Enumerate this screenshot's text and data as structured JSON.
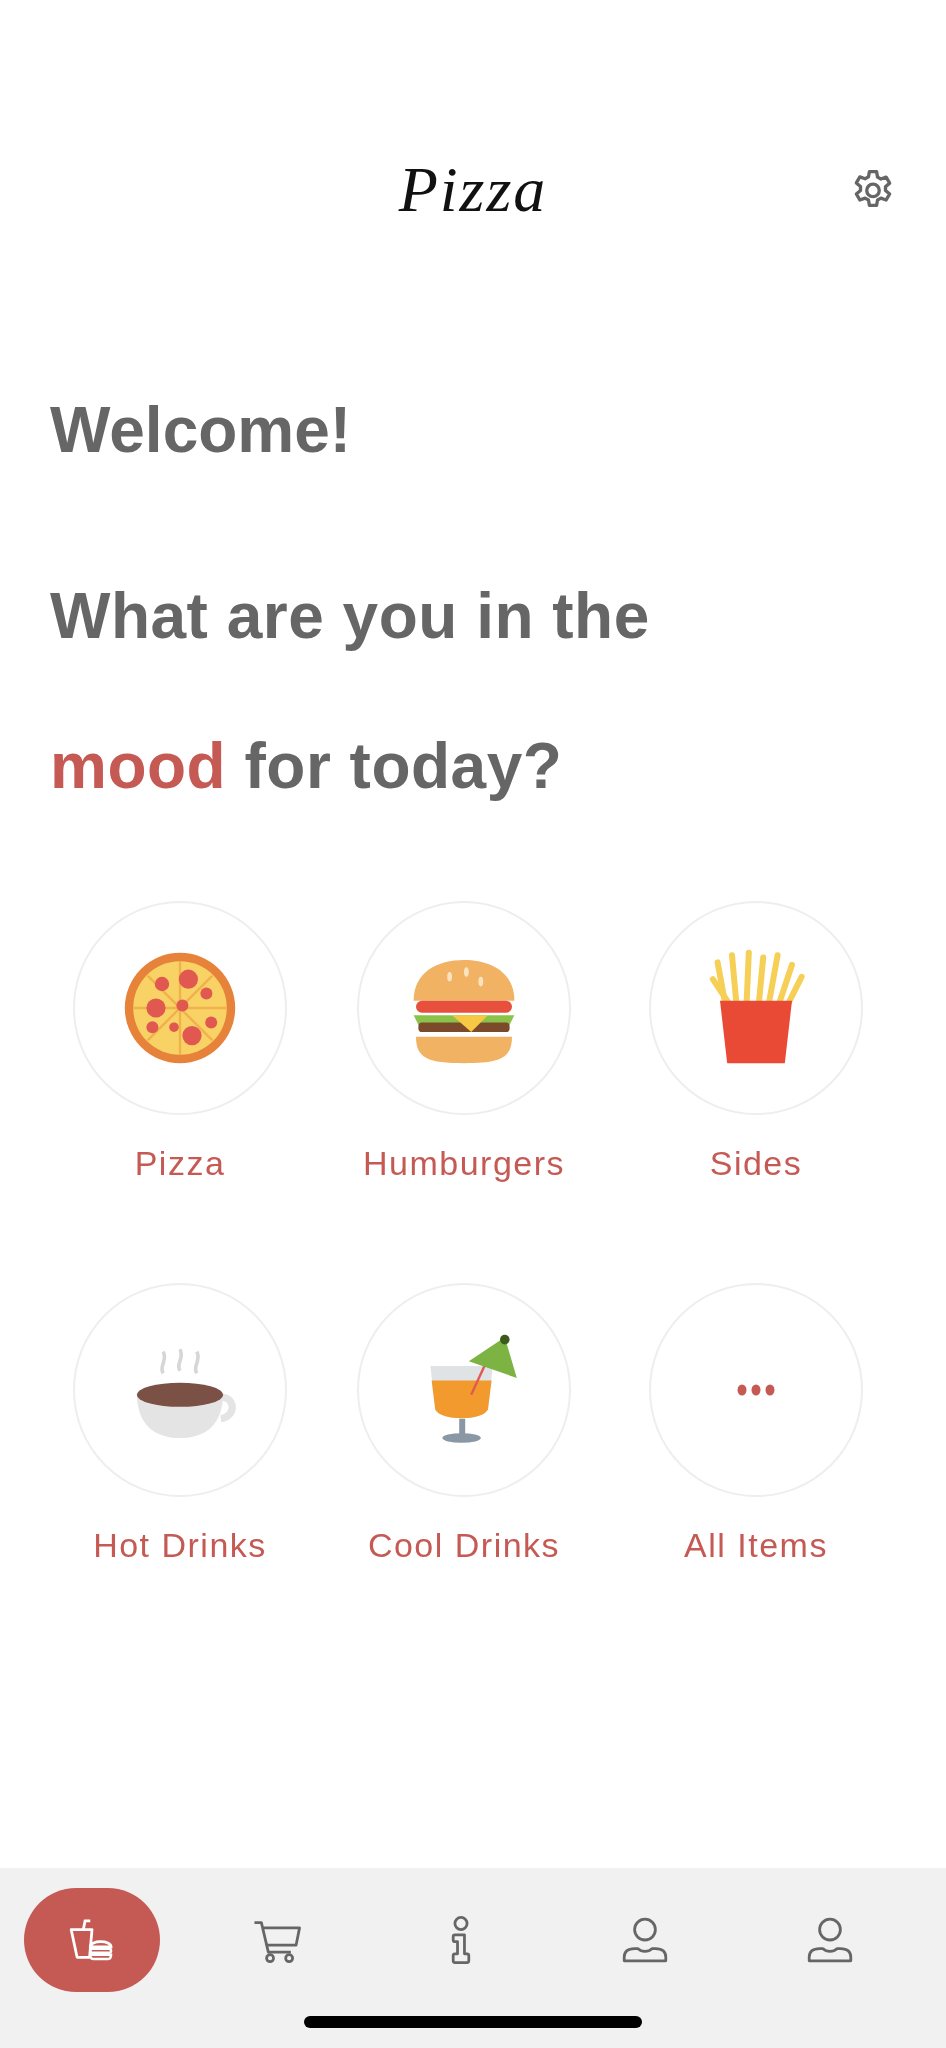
{
  "header": {
    "logo": "Pizza"
  },
  "greeting": "Welcome!",
  "headline": {
    "line_1": "What are you in the",
    "line_2": [
      {
        "text": "mood",
        "highlight": true
      },
      {
        "text": " for today?",
        "highlight": false
      }
    ]
  },
  "categories": [
    {
      "label": "Pizza",
      "kind": "pizza"
    },
    {
      "label": "Humburgers",
      "kind": "burger"
    },
    {
      "label": "Sides",
      "kind": "fries"
    },
    {
      "label": "Hot Drinks",
      "kind": "coffee"
    },
    {
      "label": "Cool Drinks",
      "kind": "cocktail"
    },
    {
      "label": "All Items",
      "kind": "more"
    }
  ],
  "tab_bar": [
    {
      "kind": "menu",
      "selected": true
    },
    {
      "kind": "cart",
      "selected": false
    },
    {
      "kind": "info",
      "selected": false
    },
    {
      "kind": "account",
      "selected": false
    },
    {
      "kind": "account",
      "selected": false
    }
  ]
}
